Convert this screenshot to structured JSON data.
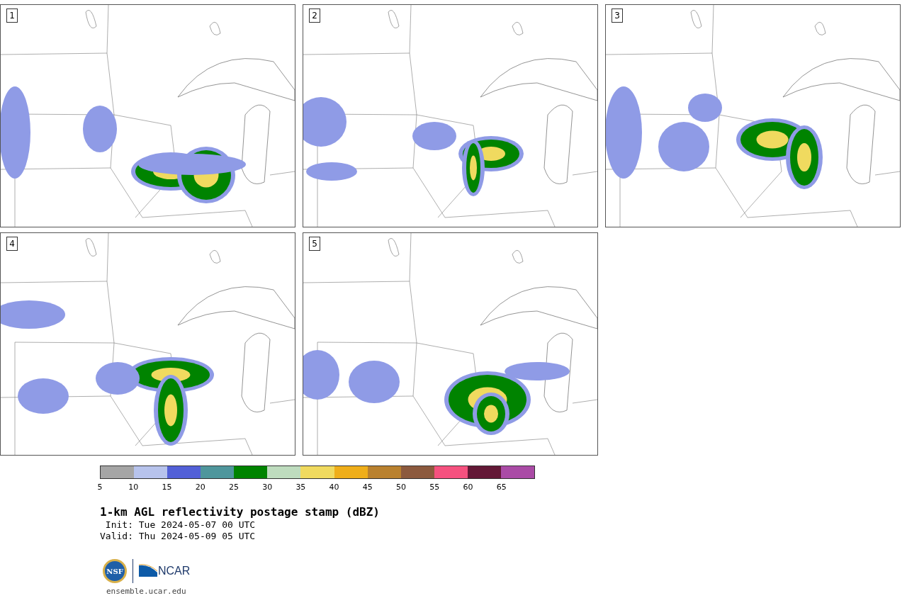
{
  "panels": [
    {
      "label": "1"
    },
    {
      "label": "2"
    },
    {
      "label": "3"
    },
    {
      "label": "4"
    },
    {
      "label": "5"
    }
  ],
  "colorbar": {
    "segments": [
      {
        "tick": "5",
        "color": "#a5a5a5"
      },
      {
        "tick": "10",
        "color": "#b7c3ec"
      },
      {
        "tick": "15",
        "color": "#5260d7"
      },
      {
        "tick": "20",
        "color": "#4f969c"
      },
      {
        "tick": "25",
        "color": "#008300"
      },
      {
        "tick": "30",
        "color": "#bedcbe"
      },
      {
        "tick": "35",
        "color": "#f0da5f"
      },
      {
        "tick": "40",
        "color": "#efae1a"
      },
      {
        "tick": "45",
        "color": "#b9812f"
      },
      {
        "tick": "50",
        "color": "#8c5a3e"
      },
      {
        "tick": "55",
        "color": "#f5517f"
      },
      {
        "tick": "60",
        "color": "#631836"
      },
      {
        "tick": "65",
        "color": "#aa4ba6"
      }
    ]
  },
  "title": "1-km AGL reflectivity postage stamp (dBZ)",
  "init": " Init: Tue 2024-05-07 00 UTC",
  "valid": "Valid: Thu 2024-05-09 05 UTC",
  "logos": {
    "nsf": "NSF",
    "ncar": "NCAR"
  },
  "site": "ensemble.ucar.edu"
}
